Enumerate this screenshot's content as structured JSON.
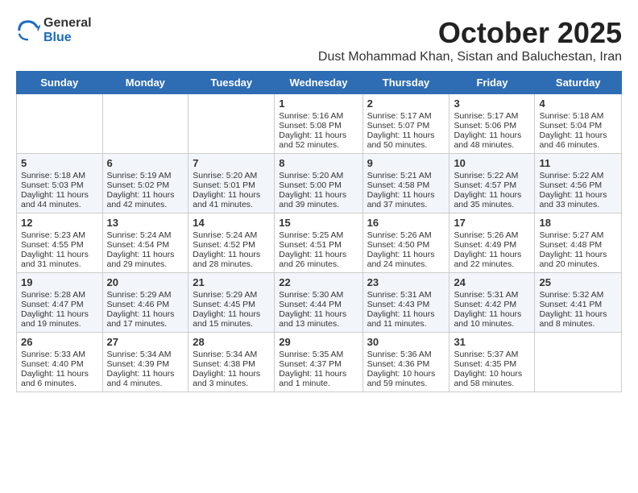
{
  "header": {
    "logo_general": "General",
    "logo_blue": "Blue",
    "month_title": "October 2025",
    "location": "Dust Mohammad Khan, Sistan and Baluchestan, Iran"
  },
  "weekdays": [
    "Sunday",
    "Monday",
    "Tuesday",
    "Wednesday",
    "Thursday",
    "Friday",
    "Saturday"
  ],
  "weeks": [
    [
      {
        "day": "",
        "info": ""
      },
      {
        "day": "",
        "info": ""
      },
      {
        "day": "",
        "info": ""
      },
      {
        "day": "1",
        "info": "Sunrise: 5:16 AM\nSunset: 5:08 PM\nDaylight: 11 hours\nand 52 minutes."
      },
      {
        "day": "2",
        "info": "Sunrise: 5:17 AM\nSunset: 5:07 PM\nDaylight: 11 hours\nand 50 minutes."
      },
      {
        "day": "3",
        "info": "Sunrise: 5:17 AM\nSunset: 5:06 PM\nDaylight: 11 hours\nand 48 minutes."
      },
      {
        "day": "4",
        "info": "Sunrise: 5:18 AM\nSunset: 5:04 PM\nDaylight: 11 hours\nand 46 minutes."
      }
    ],
    [
      {
        "day": "5",
        "info": "Sunrise: 5:18 AM\nSunset: 5:03 PM\nDaylight: 11 hours\nand 44 minutes."
      },
      {
        "day": "6",
        "info": "Sunrise: 5:19 AM\nSunset: 5:02 PM\nDaylight: 11 hours\nand 42 minutes."
      },
      {
        "day": "7",
        "info": "Sunrise: 5:20 AM\nSunset: 5:01 PM\nDaylight: 11 hours\nand 41 minutes."
      },
      {
        "day": "8",
        "info": "Sunrise: 5:20 AM\nSunset: 5:00 PM\nDaylight: 11 hours\nand 39 minutes."
      },
      {
        "day": "9",
        "info": "Sunrise: 5:21 AM\nSunset: 4:58 PM\nDaylight: 11 hours\nand 37 minutes."
      },
      {
        "day": "10",
        "info": "Sunrise: 5:22 AM\nSunset: 4:57 PM\nDaylight: 11 hours\nand 35 minutes."
      },
      {
        "day": "11",
        "info": "Sunrise: 5:22 AM\nSunset: 4:56 PM\nDaylight: 11 hours\nand 33 minutes."
      }
    ],
    [
      {
        "day": "12",
        "info": "Sunrise: 5:23 AM\nSunset: 4:55 PM\nDaylight: 11 hours\nand 31 minutes."
      },
      {
        "day": "13",
        "info": "Sunrise: 5:24 AM\nSunset: 4:54 PM\nDaylight: 11 hours\nand 29 minutes."
      },
      {
        "day": "14",
        "info": "Sunrise: 5:24 AM\nSunset: 4:52 PM\nDaylight: 11 hours\nand 28 minutes."
      },
      {
        "day": "15",
        "info": "Sunrise: 5:25 AM\nSunset: 4:51 PM\nDaylight: 11 hours\nand 26 minutes."
      },
      {
        "day": "16",
        "info": "Sunrise: 5:26 AM\nSunset: 4:50 PM\nDaylight: 11 hours\nand 24 minutes."
      },
      {
        "day": "17",
        "info": "Sunrise: 5:26 AM\nSunset: 4:49 PM\nDaylight: 11 hours\nand 22 minutes."
      },
      {
        "day": "18",
        "info": "Sunrise: 5:27 AM\nSunset: 4:48 PM\nDaylight: 11 hours\nand 20 minutes."
      }
    ],
    [
      {
        "day": "19",
        "info": "Sunrise: 5:28 AM\nSunset: 4:47 PM\nDaylight: 11 hours\nand 19 minutes."
      },
      {
        "day": "20",
        "info": "Sunrise: 5:29 AM\nSunset: 4:46 PM\nDaylight: 11 hours\nand 17 minutes."
      },
      {
        "day": "21",
        "info": "Sunrise: 5:29 AM\nSunset: 4:45 PM\nDaylight: 11 hours\nand 15 minutes."
      },
      {
        "day": "22",
        "info": "Sunrise: 5:30 AM\nSunset: 4:44 PM\nDaylight: 11 hours\nand 13 minutes."
      },
      {
        "day": "23",
        "info": "Sunrise: 5:31 AM\nSunset: 4:43 PM\nDaylight: 11 hours\nand 11 minutes."
      },
      {
        "day": "24",
        "info": "Sunrise: 5:31 AM\nSunset: 4:42 PM\nDaylight: 11 hours\nand 10 minutes."
      },
      {
        "day": "25",
        "info": "Sunrise: 5:32 AM\nSunset: 4:41 PM\nDaylight: 11 hours\nand 8 minutes."
      }
    ],
    [
      {
        "day": "26",
        "info": "Sunrise: 5:33 AM\nSunset: 4:40 PM\nDaylight: 11 hours\nand 6 minutes."
      },
      {
        "day": "27",
        "info": "Sunrise: 5:34 AM\nSunset: 4:39 PM\nDaylight: 11 hours\nand 4 minutes."
      },
      {
        "day": "28",
        "info": "Sunrise: 5:34 AM\nSunset: 4:38 PM\nDaylight: 11 hours\nand 3 minutes."
      },
      {
        "day": "29",
        "info": "Sunrise: 5:35 AM\nSunset: 4:37 PM\nDaylight: 11 hours\nand 1 minute."
      },
      {
        "day": "30",
        "info": "Sunrise: 5:36 AM\nSunset: 4:36 PM\nDaylight: 10 hours\nand 59 minutes."
      },
      {
        "day": "31",
        "info": "Sunrise: 5:37 AM\nSunset: 4:35 PM\nDaylight: 10 hours\nand 58 minutes."
      },
      {
        "day": "",
        "info": ""
      }
    ]
  ]
}
